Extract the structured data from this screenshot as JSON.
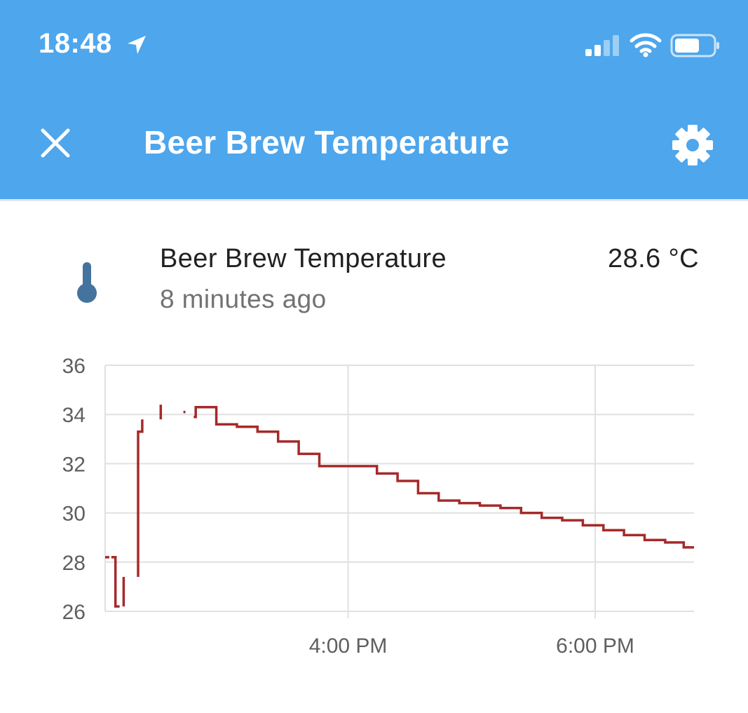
{
  "status_bar": {
    "time": "18:48",
    "icons": [
      "location-arrow-icon",
      "signal-icon",
      "wifi-icon",
      "battery-icon"
    ]
  },
  "app_bar": {
    "title": "Beer Brew Temperature",
    "close_icon": "close-icon",
    "settings_icon": "gear-icon",
    "color": "#4ea6ec"
  },
  "entity": {
    "name": "Beer Brew Temperature",
    "last_changed": "8 minutes ago",
    "state": "28.6 °C",
    "icon": "thermometer-icon",
    "icon_color": "#44739e"
  },
  "chart_data": {
    "type": "line",
    "step": true,
    "line_color": "#a52a2a",
    "grid": true,
    "ylim": [
      26,
      36
    ],
    "yticks": [
      36,
      34,
      32,
      30,
      28,
      26
    ],
    "xlim": [
      "14:02",
      "18:48"
    ],
    "xticks": [
      {
        "label": "4:00 PM",
        "time": "16:00"
      },
      {
        "label": "6:00 PM",
        "time": "18:00"
      }
    ],
    "segments": [
      [
        [
          "14:02",
          28.2
        ],
        [
          "14:04",
          28.2
        ]
      ],
      [
        [
          "14:05",
          28.2
        ],
        [
          "14:07",
          28.2
        ],
        [
          "14:07",
          26.2
        ],
        [
          "14:09",
          26.2
        ]
      ],
      [
        [
          "14:11",
          26.2
        ],
        [
          "14:11",
          27.4
        ]
      ],
      [
        [
          "14:18",
          27.4
        ],
        [
          "14:18",
          33.3
        ],
        [
          "14:20",
          33.3
        ],
        [
          "14:20",
          33.8
        ]
      ],
      [
        [
          "14:29",
          34.4
        ],
        [
          "14:29",
          33.8
        ]
      ],
      [
        [
          "14:40",
          34.1
        ],
        [
          "14:41",
          34.1
        ]
      ],
      [
        [
          "14:45",
          33.9
        ],
        [
          "14:46",
          33.9
        ],
        [
          "14:46",
          34.3
        ],
        [
          "14:56",
          34.3
        ],
        [
          "14:56",
          33.6
        ],
        [
          "15:06",
          33.6
        ],
        [
          "15:06",
          33.5
        ],
        [
          "15:16",
          33.5
        ],
        [
          "15:16",
          33.3
        ],
        [
          "15:26",
          33.3
        ],
        [
          "15:26",
          32.9
        ],
        [
          "15:36",
          32.9
        ],
        [
          "15:36",
          32.4
        ],
        [
          "15:46",
          32.4
        ],
        [
          "15:46",
          31.9
        ],
        [
          "16:14",
          31.9
        ],
        [
          "16:14",
          31.6
        ],
        [
          "16:24",
          31.6
        ],
        [
          "16:24",
          31.3
        ],
        [
          "16:34",
          31.3
        ],
        [
          "16:34",
          30.8
        ],
        [
          "16:44",
          30.8
        ],
        [
          "16:44",
          30.5
        ],
        [
          "16:54",
          30.5
        ],
        [
          "16:54",
          30.4
        ],
        [
          "17:04",
          30.4
        ],
        [
          "17:04",
          30.3
        ],
        [
          "17:14",
          30.3
        ],
        [
          "17:14",
          30.2
        ],
        [
          "17:24",
          30.2
        ],
        [
          "17:24",
          30.0
        ],
        [
          "17:34",
          30.0
        ],
        [
          "17:34",
          29.8
        ],
        [
          "17:44",
          29.8
        ],
        [
          "17:44",
          29.7
        ],
        [
          "17:54",
          29.7
        ],
        [
          "17:54",
          29.5
        ],
        [
          "18:04",
          29.5
        ],
        [
          "18:04",
          29.3
        ],
        [
          "18:14",
          29.3
        ],
        [
          "18:14",
          29.1
        ],
        [
          "18:24",
          29.1
        ],
        [
          "18:24",
          28.9
        ],
        [
          "18:34",
          28.9
        ],
        [
          "18:34",
          28.8
        ],
        [
          "18:43",
          28.8
        ],
        [
          "18:43",
          28.6
        ],
        [
          "18:48",
          28.6
        ]
      ]
    ]
  }
}
